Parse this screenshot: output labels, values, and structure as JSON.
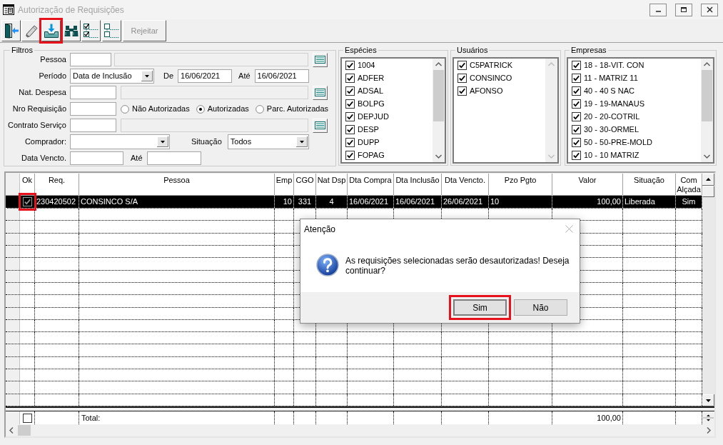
{
  "window": {
    "title": "Autorização de Requisições",
    "active": false
  },
  "toolbar": [
    {
      "kind": "exit",
      "highlighted": false
    },
    {
      "kind": "eraser",
      "highlighted": false
    },
    {
      "kind": "import",
      "highlighted": true
    },
    {
      "kind": "binoculars",
      "highlighted": false
    },
    {
      "kind": "check_all",
      "highlighted": false
    },
    {
      "kind": "uncheck_all",
      "highlighted": false
    },
    {
      "kind": "text",
      "label": "Rejeitar",
      "disabled": true,
      "highlighted": false
    }
  ],
  "filters": {
    "title": "Filtros",
    "pessoa": {
      "label": "Pessoa"
    },
    "periodo": {
      "label": "Período",
      "value": "Data de Inclusão",
      "from_label": "De",
      "from": "16/06/2021",
      "to_label": "Até",
      "to": "16/06/2021"
    },
    "nat_despesa": {
      "label": "Nat. Despesa"
    },
    "nro_requisicao": {
      "label": "Nro Requisição",
      "options": [
        {
          "label": "Não Autorizadas",
          "selected": false
        },
        {
          "label": "Autorizadas",
          "selected": true
        },
        {
          "label": "Parc. Autorizadas",
          "selected": false
        }
      ]
    },
    "contrato_servico": {
      "label": "Contrato Serviço"
    },
    "comprador": {
      "label": "Comprador:"
    },
    "situacao": {
      "label": "Situação",
      "value": "Todos"
    },
    "data_vencto": {
      "label": "Data Vencto.",
      "to_label": "Até"
    }
  },
  "lists": [
    {
      "title": "Espécies",
      "items": [
        {
          "label": "1004",
          "checked": true
        },
        {
          "label": "ADFER",
          "checked": true
        },
        {
          "label": "ADSAL",
          "checked": true
        },
        {
          "label": "BOLPG",
          "checked": true
        },
        {
          "label": "DEPJUD",
          "checked": true
        },
        {
          "label": "DESP",
          "checked": true
        },
        {
          "label": "DUPP",
          "checked": true
        },
        {
          "label": "FOPAG",
          "checked": true
        }
      ]
    },
    {
      "title": "Usuários",
      "items": [
        {
          "label": "C5PATRICK",
          "checked": true
        },
        {
          "label": "CONSINCO",
          "checked": true
        },
        {
          "label": "AFONSO",
          "checked": true
        }
      ]
    },
    {
      "title": "Empresas",
      "items": [
        {
          "label": "18 - 18-VIT. CON",
          "checked": true
        },
        {
          "label": "11 - MATRIZ 11",
          "checked": true
        },
        {
          "label": "40 - 40 S NAC",
          "checked": true
        },
        {
          "label": "19 - 19-MANAUS",
          "checked": true
        },
        {
          "label": "20 - 20-COTRIL",
          "checked": true
        },
        {
          "label": "30 - 30-ORMEL",
          "checked": true
        },
        {
          "label": "50 - 50-PRE-MOLD",
          "checked": true
        },
        {
          "label": "10 - 10 MATRIZ",
          "checked": true
        }
      ]
    }
  ],
  "table": {
    "columns": [
      "Ok",
      "Req.",
      "Pessoa",
      "Emp",
      "CGO",
      "Nat Dsp",
      "Dta Compra",
      "Dta Inclusão",
      "Dta Vencto.",
      "Pzo Pgto",
      "Valor",
      "Situação",
      "Com Alçada"
    ],
    "rows": [
      {
        "selected": true,
        "cells": [
          {
            "kind": "checkbox",
            "checked": true,
            "highlighted": true
          },
          "230420502",
          "CONSINCO S/A",
          "10",
          "331",
          "4",
          "16/06/2021",
          "16/06/2021",
          "26/06/2021",
          "10",
          "100,00",
          "Liberada",
          "Sim"
        ]
      }
    ],
    "total": {
      "checked": false,
      "label": "Total:",
      "valor": "100,00"
    }
  },
  "dialog": {
    "title": "Atenção",
    "message": "As requisições selecionadas serão desautorizadas! Deseja continuar?",
    "buttons": [
      {
        "label": "Sim",
        "default": true,
        "highlighted": true
      },
      {
        "label": "Não",
        "default": false,
        "highlighted": false
      }
    ]
  }
}
